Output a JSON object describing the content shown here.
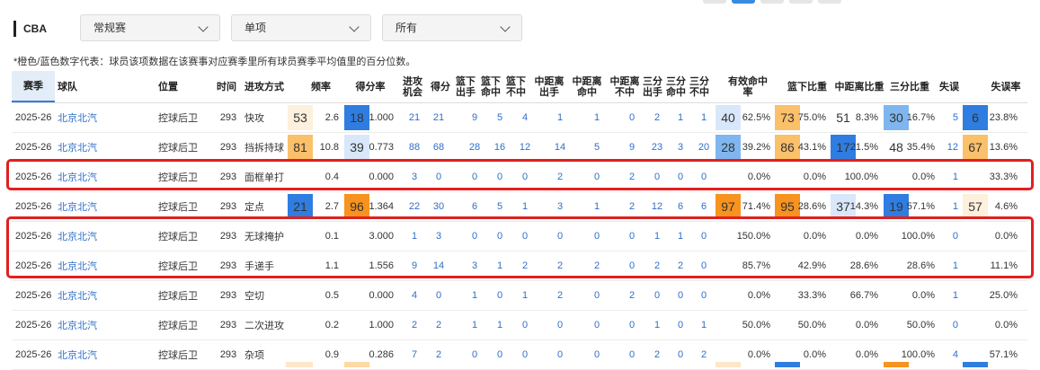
{
  "filters": {
    "league": "CBA",
    "season_type": "常规赛",
    "split": "单项",
    "scope": "所有"
  },
  "note": "*橙色/蓝色数字代表：球员该项数据在该赛事对应赛季里所有球员赛季平均值里的百分位数。",
  "colors": {
    "hot_strong": "#f7931e",
    "hot_mid": "#fbc06a",
    "hot_light": "#fdf0dc",
    "cold_strong": "#2f7de1",
    "cold_mid": "#7fb6f0",
    "cold_light": "#d8e8fa",
    "highlight_border": "#e02020",
    "link": "#2f6fc9"
  },
  "headers": {
    "season": "赛季",
    "team": "球队",
    "position": "位置",
    "time": "时间",
    "play_type": "进攻方式",
    "frequency": "频率",
    "ppp": "得分率",
    "possessions": "进攻机会",
    "points": "得分",
    "rim_fga": "篮下出手",
    "rim_fgm": "篮下命中",
    "rim_miss": "篮下不中",
    "mid_fga": "中距离出手",
    "mid_fgm": "中距离命中",
    "mid_miss": "中距离不中",
    "three_fga": "三分出手",
    "three_fgm": "三分命中",
    "three_miss": "三分不中",
    "efg": "有效命中率",
    "rim_share": "篮下比重",
    "mid_share": "中距离比重",
    "three_share": "三分比重",
    "turnovers": "失误",
    "tov_rate": "失误率"
  },
  "rows": [
    {
      "season": "2025-26",
      "team": "北京北汽",
      "position": "控球后卫",
      "time": "293",
      "play_type": "快攻",
      "freq_pct": "53",
      "freq_pct_tier": "hot_light",
      "frequency": "2.6",
      "ppp_pct": "18",
      "ppp_pct_tier": "cold_strong",
      "ppp": "1.000",
      "possessions": "21",
      "points": "21",
      "rim_fga": "9",
      "rim_fgm": "5",
      "rim_miss": "4",
      "mid_fga": "1",
      "mid_fgm": "1",
      "mid_miss": "0",
      "three_fga": "2",
      "three_fgm": "1",
      "three_miss": "1",
      "efg_pct": "40",
      "efg_pct_tier": "cold_light",
      "efg": "62.5%",
      "rim_pct": "73",
      "rim_pct_tier": "hot_mid",
      "rim_share": "75.0%",
      "mid_pct": "51",
      "mid_pct_tier": "none",
      "mid_share": "8.3%",
      "three_pct": "30",
      "three_pct_tier": "cold_mid",
      "three_share": "16.7%",
      "turnovers": "5",
      "tov_pct": "6",
      "tov_pct_tier": "cold_strong",
      "tov_rate": "23.8%"
    },
    {
      "season": "2025-26",
      "team": "北京北汽",
      "position": "控球后卫",
      "time": "293",
      "play_type": "挡拆持球",
      "freq_pct": "81",
      "freq_pct_tier": "hot_mid",
      "frequency": "10.8",
      "ppp_pct": "39",
      "ppp_pct_tier": "cold_light",
      "ppp": "0.773",
      "possessions": "88",
      "points": "68",
      "rim_fga": "28",
      "rim_fgm": "16",
      "rim_miss": "12",
      "mid_fga": "14",
      "mid_fgm": "5",
      "mid_miss": "9",
      "three_fga": "23",
      "three_fgm": "3",
      "three_miss": "20",
      "efg_pct": "28",
      "efg_pct_tier": "cold_mid",
      "efg": "39.2%",
      "rim_pct": "86",
      "rim_pct_tier": "hot_mid",
      "rim_share": "43.1%",
      "mid_pct": "17",
      "mid_pct_tier": "cold_strong",
      "mid_share": "21.5%",
      "three_pct": "48",
      "three_pct_tier": "none",
      "three_share": "35.4%",
      "turnovers": "12",
      "tov_pct": "67",
      "tov_pct_tier": "hot_mid",
      "tov_rate": "13.6%"
    },
    {
      "season": "2025-26",
      "team": "北京北汽",
      "position": "控球后卫",
      "time": "293",
      "play_type": "面框单打",
      "freq_pct": "",
      "freq_pct_tier": "none",
      "frequency": "0.4",
      "ppp_pct": "",
      "ppp_pct_tier": "none",
      "ppp": "0.000",
      "possessions": "3",
      "points": "0",
      "rim_fga": "0",
      "rim_fgm": "0",
      "rim_miss": "0",
      "mid_fga": "2",
      "mid_fgm": "0",
      "mid_miss": "2",
      "three_fga": "0",
      "three_fgm": "0",
      "three_miss": "0",
      "efg_pct": "",
      "efg_pct_tier": "none",
      "efg": "0.0%",
      "rim_pct": "",
      "rim_pct_tier": "none",
      "rim_share": "0.0%",
      "mid_pct": "",
      "mid_pct_tier": "none",
      "mid_share": "100.0%",
      "three_pct": "",
      "three_pct_tier": "none",
      "three_share": "0.0%",
      "turnovers": "1",
      "tov_pct": "",
      "tov_pct_tier": "none",
      "tov_rate": "33.3%"
    },
    {
      "season": "2025-26",
      "team": "北京北汽",
      "position": "控球后卫",
      "time": "293",
      "play_type": "定点",
      "freq_pct": "21",
      "freq_pct_tier": "cold_strong",
      "frequency": "2.7",
      "ppp_pct": "96",
      "ppp_pct_tier": "hot_strong",
      "ppp": "1.364",
      "possessions": "22",
      "points": "30",
      "rim_fga": "6",
      "rim_fgm": "5",
      "rim_miss": "1",
      "mid_fga": "3",
      "mid_fgm": "1",
      "mid_miss": "2",
      "three_fga": "12",
      "three_fgm": "6",
      "three_miss": "6",
      "efg_pct": "97",
      "efg_pct_tier": "hot_strong",
      "efg": "71.4%",
      "rim_pct": "95",
      "rim_pct_tier": "hot_strong",
      "rim_share": "28.6%",
      "mid_pct": "37",
      "mid_pct_tier": "cold_light",
      "mid_share": "14.3%",
      "three_pct": "19",
      "three_pct_tier": "cold_strong",
      "three_share": "57.1%",
      "turnovers": "1",
      "tov_pct": "57",
      "tov_pct_tier": "hot_light",
      "tov_rate": "4.6%"
    },
    {
      "season": "2025-26",
      "team": "北京北汽",
      "position": "控球后卫",
      "time": "293",
      "play_type": "无球掩护",
      "freq_pct": "",
      "freq_pct_tier": "none",
      "frequency": "0.1",
      "ppp_pct": "",
      "ppp_pct_tier": "none",
      "ppp": "3.000",
      "possessions": "1",
      "points": "3",
      "rim_fga": "0",
      "rim_fgm": "0",
      "rim_miss": "0",
      "mid_fga": "0",
      "mid_fgm": "0",
      "mid_miss": "0",
      "three_fga": "1",
      "three_fgm": "1",
      "three_miss": "0",
      "efg_pct": "",
      "efg_pct_tier": "none",
      "efg": "150.0%",
      "rim_pct": "",
      "rim_pct_tier": "none",
      "rim_share": "0.0%",
      "mid_pct": "",
      "mid_pct_tier": "none",
      "mid_share": "0.0%",
      "three_pct": "",
      "three_pct_tier": "none",
      "three_share": "100.0%",
      "turnovers": "0",
      "tov_pct": "",
      "tov_pct_tier": "none",
      "tov_rate": "0.0%"
    },
    {
      "season": "2025-26",
      "team": "北京北汽",
      "position": "控球后卫",
      "time": "293",
      "play_type": "手递手",
      "freq_pct": "",
      "freq_pct_tier": "none",
      "frequency": "1.1",
      "ppp_pct": "",
      "ppp_pct_tier": "none",
      "ppp": "1.556",
      "possessions": "9",
      "points": "14",
      "rim_fga": "3",
      "rim_fgm": "1",
      "rim_miss": "2",
      "mid_fga": "2",
      "mid_fgm": "2",
      "mid_miss": "0",
      "three_fga": "2",
      "three_fgm": "2",
      "three_miss": "0",
      "efg_pct": "",
      "efg_pct_tier": "none",
      "efg": "85.7%",
      "rim_pct": "",
      "rim_pct_tier": "none",
      "rim_share": "42.9%",
      "mid_pct": "",
      "mid_pct_tier": "none",
      "mid_share": "28.6%",
      "three_pct": "",
      "three_pct_tier": "none",
      "three_share": "28.6%",
      "turnovers": "1",
      "tov_pct": "",
      "tov_pct_tier": "none",
      "tov_rate": "11.1%"
    },
    {
      "season": "2025-26",
      "team": "北京北汽",
      "position": "控球后卫",
      "time": "293",
      "play_type": "空切",
      "freq_pct": "",
      "freq_pct_tier": "none",
      "frequency": "0.5",
      "ppp_pct": "",
      "ppp_pct_tier": "none",
      "ppp": "0.000",
      "possessions": "4",
      "points": "0",
      "rim_fga": "1",
      "rim_fgm": "0",
      "rim_miss": "1",
      "mid_fga": "2",
      "mid_fgm": "0",
      "mid_miss": "2",
      "three_fga": "0",
      "three_fgm": "0",
      "three_miss": "0",
      "efg_pct": "",
      "efg_pct_tier": "none",
      "efg": "0.0%",
      "rim_pct": "",
      "rim_pct_tier": "none",
      "rim_share": "33.3%",
      "mid_pct": "",
      "mid_pct_tier": "none",
      "mid_share": "66.7%",
      "three_pct": "",
      "three_pct_tier": "none",
      "three_share": "0.0%",
      "turnovers": "1",
      "tov_pct": "",
      "tov_pct_tier": "none",
      "tov_rate": "25.0%"
    },
    {
      "season": "2025-26",
      "team": "北京北汽",
      "position": "控球后卫",
      "time": "293",
      "play_type": "二次进攻",
      "freq_pct": "",
      "freq_pct_tier": "none",
      "frequency": "0.2",
      "ppp_pct": "",
      "ppp_pct_tier": "none",
      "ppp": "1.000",
      "possessions": "2",
      "points": "2",
      "rim_fga": "1",
      "rim_fgm": "1",
      "rim_miss": "0",
      "mid_fga": "0",
      "mid_fgm": "0",
      "mid_miss": "0",
      "three_fga": "1",
      "three_fgm": "0",
      "three_miss": "1",
      "efg_pct": "",
      "efg_pct_tier": "none",
      "efg": "50.0%",
      "rim_pct": "",
      "rim_pct_tier": "none",
      "rim_share": "50.0%",
      "mid_pct": "",
      "mid_pct_tier": "none",
      "mid_share": "0.0%",
      "three_pct": "",
      "three_pct_tier": "none",
      "three_share": "50.0%",
      "turnovers": "0",
      "tov_pct": "",
      "tov_pct_tier": "none",
      "tov_rate": "0.0%"
    },
    {
      "season": "2025-26",
      "team": "北京北汽",
      "position": "控球后卫",
      "time": "293",
      "play_type": "杂项",
      "freq_pct": "",
      "freq_pct_tier": "none",
      "frequency": "0.9",
      "ppp_pct": "",
      "ppp_pct_tier": "none",
      "ppp": "0.286",
      "possessions": "7",
      "points": "2",
      "rim_fga": "0",
      "rim_fgm": "0",
      "rim_miss": "0",
      "mid_fga": "0",
      "mid_fgm": "0",
      "mid_miss": "0",
      "three_fga": "2",
      "three_fgm": "0",
      "three_miss": "2",
      "efg_pct": "",
      "efg_pct_tier": "none",
      "efg": "0.0%",
      "rim_pct": "",
      "rim_pct_tier": "none",
      "rim_share": "0.0%",
      "mid_pct": "",
      "mid_pct_tier": "none",
      "mid_share": "0.0%",
      "three_pct": "",
      "three_pct_tier": "none",
      "three_share": "100.0%",
      "turnovers": "4",
      "tov_pct": "",
      "tov_pct_tier": "none",
      "tov_rate": "57.1%"
    }
  ]
}
